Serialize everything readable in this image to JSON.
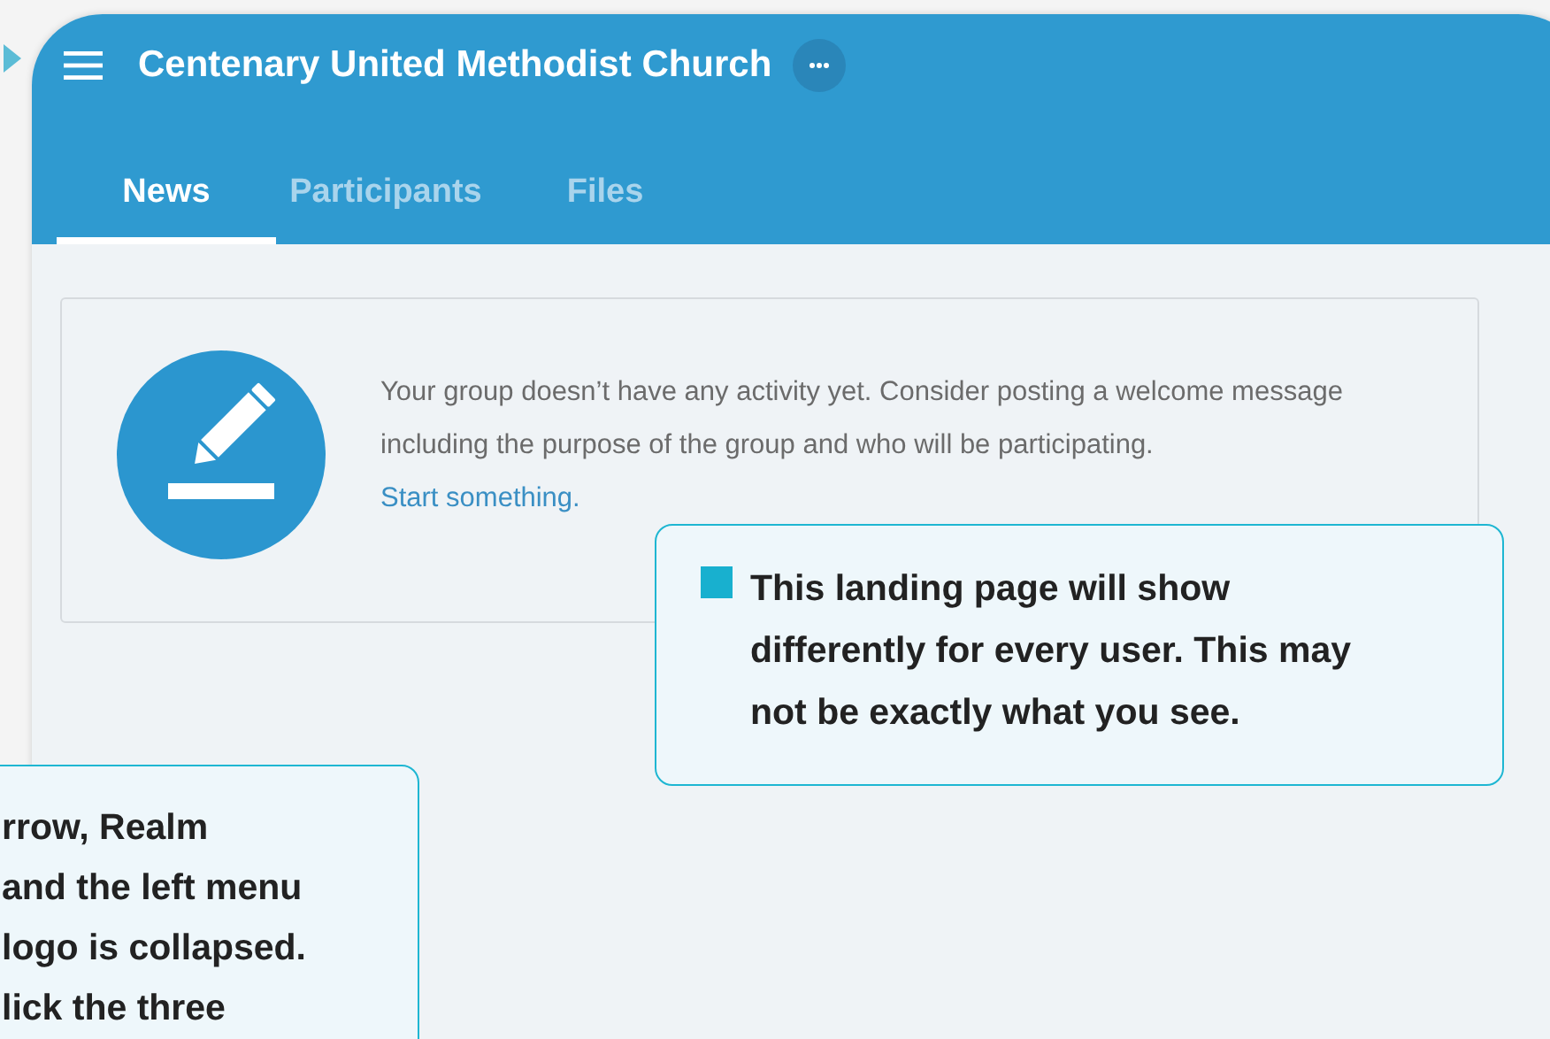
{
  "header": {
    "title": "Centenary United Methodist Church"
  },
  "tabs": [
    {
      "label": "News",
      "selected": true
    },
    {
      "label": "Participants",
      "selected": false
    },
    {
      "label": "Files",
      "selected": false
    }
  ],
  "empty_state": {
    "message": "Your group doesn’t have any activity yet. Consider posting a welcome message including the purpose of the group and who will be participating.",
    "link": "Start something."
  },
  "callouts": [
    {
      "text": "This landing page will show\ndifferently for every user. This may\nnot be exactly what you see."
    },
    {
      "text": "rrow, Realm\nand the left menu\nlogo is collapsed.\nlick the three"
    }
  ]
}
